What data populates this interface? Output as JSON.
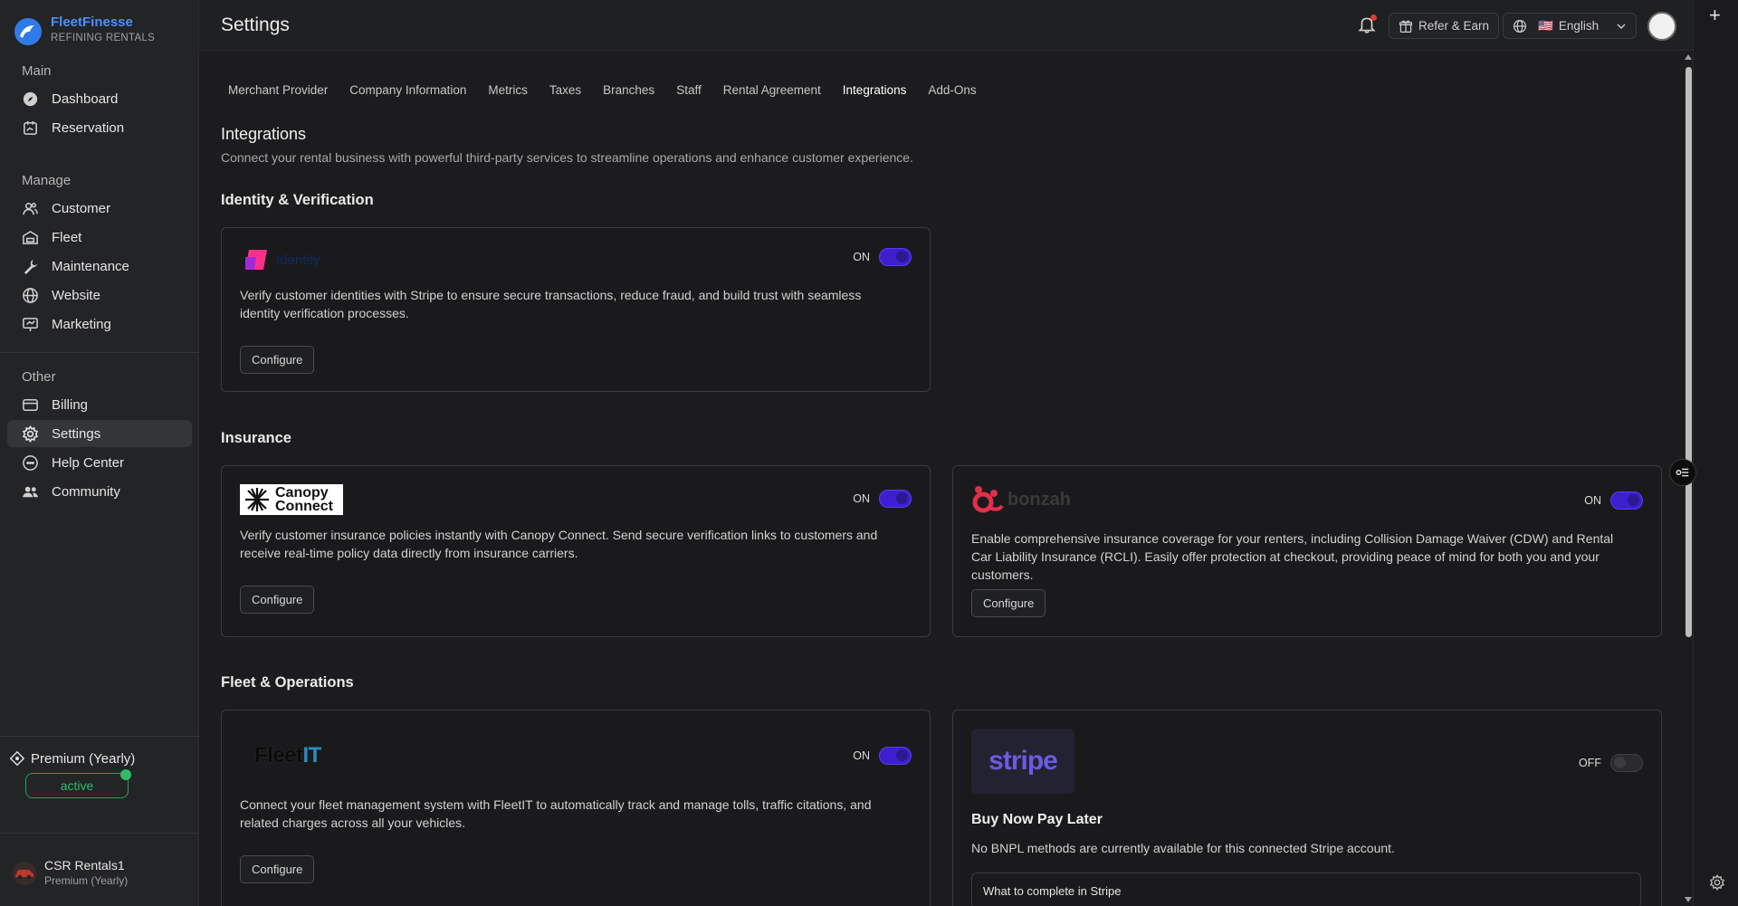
{
  "brand": {
    "name": "FleetFinesse",
    "tagline": "REFINING RENTALS"
  },
  "sidebar": {
    "sections": [
      {
        "label": "Main"
      },
      {
        "label": "Manage"
      },
      {
        "label": "Other"
      }
    ],
    "items": [
      {
        "label": "Dashboard"
      },
      {
        "label": "Reservation"
      },
      {
        "label": "Customer"
      },
      {
        "label": "Fleet"
      },
      {
        "label": "Maintenance"
      },
      {
        "label": "Website"
      },
      {
        "label": "Marketing"
      },
      {
        "label": "Billing"
      },
      {
        "label": "Settings"
      },
      {
        "label": "Help Center"
      },
      {
        "label": "Community"
      }
    ],
    "plan": "Premium (Yearly)",
    "plan_status": "active",
    "account_name": "CSR Rentals1",
    "account_plan": "Premium (Yearly)"
  },
  "header": {
    "title": "Settings",
    "refer_label": "Refer & Earn",
    "language_flag": "🇺🇸",
    "language": "English"
  },
  "tabs": [
    {
      "label": "Merchant Provider"
    },
    {
      "label": "Company Information"
    },
    {
      "label": "Metrics"
    },
    {
      "label": "Taxes"
    },
    {
      "label": "Branches"
    },
    {
      "label": "Staff"
    },
    {
      "label": "Rental Agreement"
    },
    {
      "label": "Integrations",
      "active": true
    },
    {
      "label": "Add-Ons"
    }
  ],
  "integrations": {
    "title": "Integrations",
    "subtitle": "Connect your rental business with powerful third-party services to streamline operations and enhance customer experience."
  },
  "sections": {
    "identity": "Identity & Verification",
    "insurance": "Insurance",
    "fleet_ops": "Fleet & Operations"
  },
  "cards": {
    "stripe_identity": {
      "logo_text": "Identity",
      "toggle": "ON",
      "desc": "Verify customer identities with Stripe to ensure secure transactions, reduce fraud, and build trust with seamless identity verification processes.",
      "button": "Configure"
    },
    "canopy": {
      "logo_text": "Canopy Connect",
      "toggle": "ON",
      "desc": "Verify customer insurance policies instantly with Canopy Connect. Send secure verification links to customers and receive real-time policy data directly from insurance carriers.",
      "button": "Configure"
    },
    "bonzah": {
      "logo_text": "bonzah",
      "toggle": "ON",
      "desc": "Enable comprehensive insurance coverage for your renters, including Collision Damage Waiver (CDW) and Rental Car Liability Insurance (RCLI). Easily offer protection at checkout, providing peace of mind for both you and your customers.",
      "button": "Configure"
    },
    "fleetit": {
      "logo_text_a": "Fleet",
      "logo_text_b": "IT",
      "toggle": "ON",
      "desc": "Connect your fleet management system with FleetIT to automatically track and manage tolls, traffic citations, and related charges across all your vehicles.",
      "button": "Configure"
    },
    "stripe_bnpl": {
      "logo_text": "stripe",
      "toggle": "OFF",
      "title": "Buy Now Pay Later",
      "desc": "No BNPL methods are currently available for this connected Stripe account.",
      "complete_label": "What to complete in Stripe"
    }
  },
  "colors": {
    "accent": "#4a90f5",
    "toggle_on": "#3d1fd0",
    "active_green": "#2fbf6d"
  }
}
